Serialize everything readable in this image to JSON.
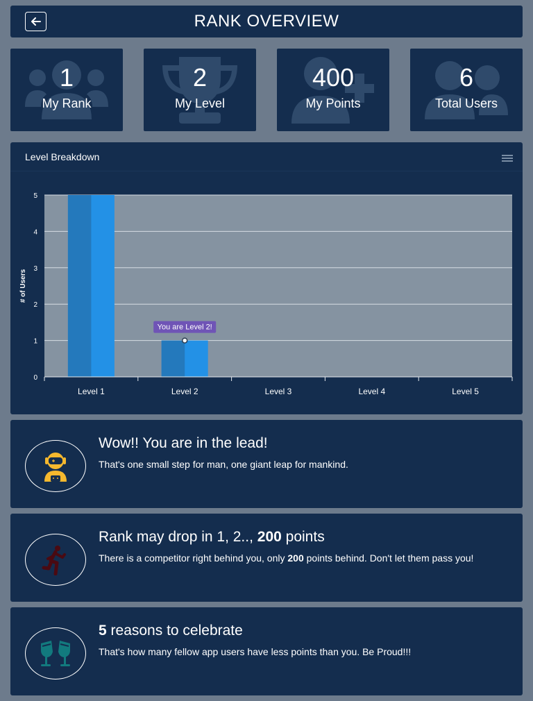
{
  "header": {
    "title": "RANK OVERVIEW",
    "back_icon": "arrow-left-icon"
  },
  "stats": [
    {
      "value": "1",
      "label": "My Rank",
      "icon": "users-group-icon"
    },
    {
      "value": "2",
      "label": "My Level",
      "icon": "trophy-icon"
    },
    {
      "value": "400",
      "label": "My Points",
      "icon": "user-plus-icon"
    },
    {
      "value": "6",
      "label": "Total Users",
      "icon": "users-icon"
    }
  ],
  "chart": {
    "title": "Level Breakdown",
    "menu_icon": "hamburger-menu-icon"
  },
  "chart_data": {
    "type": "bar",
    "categories": [
      "Level 1",
      "Level 2",
      "Level 3",
      "Level 4",
      "Level 5"
    ],
    "values": [
      5,
      1,
      0,
      0,
      0
    ],
    "ylabel": "# of Users",
    "xlabel": "",
    "ylim": [
      0,
      5
    ],
    "yticks": [
      "0",
      "1",
      "2",
      "3",
      "4",
      "5"
    ],
    "grid": true,
    "tooltip": {
      "text": "You are Level 2!",
      "category": "Level 2"
    },
    "colors": {
      "bar": "#2391e6",
      "bar_shade": "#2479bc",
      "plot_bg": "#8593a1",
      "tooltip_bg": "#6f54b6"
    }
  },
  "messages": [
    {
      "icon": "astronaut-icon",
      "heading_pre": "Wow!! You are in the lead!",
      "heading_bold": "",
      "heading_post": "",
      "body_pre": "That's one small step for man, one giant leap for mankind.",
      "body_bold": "",
      "body_post": ""
    },
    {
      "icon": "running-person-icon",
      "heading_pre": "Rank may drop in 1, 2.., ",
      "heading_bold": "200",
      "heading_post": " points",
      "body_pre": "There is a competitor right behind you, only ",
      "body_bold": "200",
      "body_post": " points behind. Don't let them pass you!"
    },
    {
      "icon": "glasses-cheers-icon",
      "heading_pre": "",
      "heading_bold": "5",
      "heading_post": " reasons to celebrate",
      "body_pre": "That's how many fellow app users have less points than you. Be Proud!!!",
      "body_bold": "",
      "body_post": ""
    }
  ],
  "colors": {
    "page_bg": "#6d7b8c",
    "panel_bg": "#142d4e",
    "icon_faint": "#2f4a6b"
  }
}
